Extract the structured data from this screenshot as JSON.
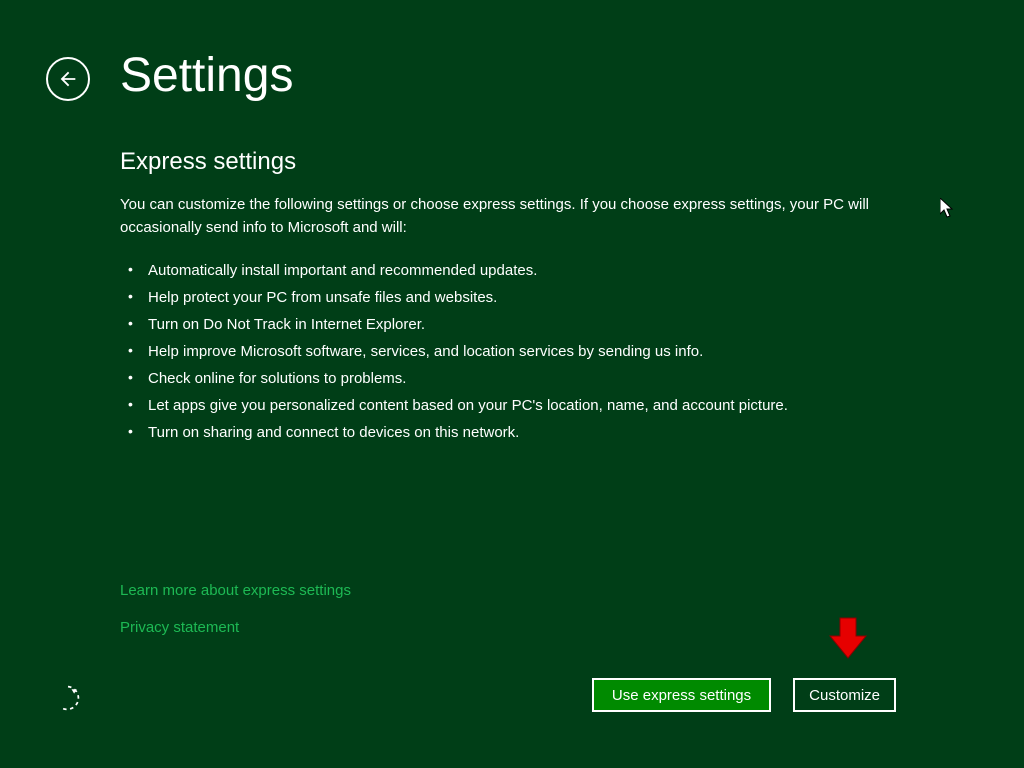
{
  "header": {
    "title": "Settings"
  },
  "section": {
    "subtitle": "Express settings",
    "intro": "You can customize the following settings or choose express settings. If you choose express settings, your PC will occasionally send info to Microsoft and will:",
    "bullets": [
      "Automatically install important and recommended updates.",
      "Help protect your PC from unsafe files and websites.",
      "Turn on Do Not Track in Internet Explorer.",
      "Help improve Microsoft software, services, and location services by sending us info.",
      "Check online for solutions to problems.",
      "Let apps give you personalized content based on your PC's location, name, and account picture.",
      "Turn on sharing and connect to devices on this network."
    ]
  },
  "links": {
    "learn_more": "Learn more about express settings",
    "privacy": "Privacy statement"
  },
  "buttons": {
    "primary": "Use express settings",
    "secondary": "Customize"
  },
  "colors": {
    "background": "#003e17",
    "accent_green": "#008a00",
    "link_green": "#1db954",
    "arrow_red": "#e60000"
  }
}
